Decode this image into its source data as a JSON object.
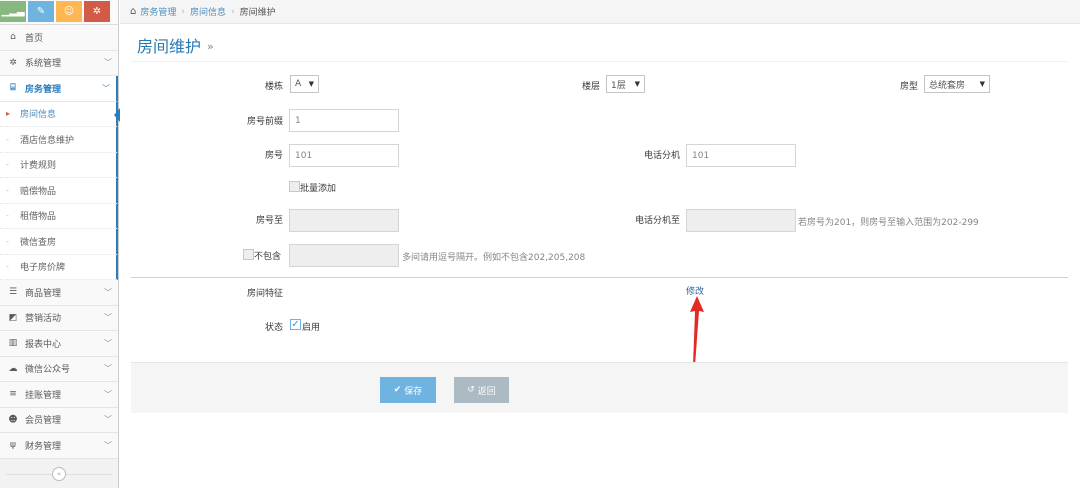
{
  "breadcrumb": {
    "items": [
      "房务管理",
      "房间信息",
      "房间维护"
    ]
  },
  "page": {
    "title": "房间维护",
    "title_arrow": "»"
  },
  "sidebar": {
    "shortcut_icons": [
      "signal-icon",
      "pencil-icon",
      "users-icon",
      "cogs-icon"
    ],
    "items": [
      {
        "label": "首页",
        "icon": "home-icon",
        "glyph": "⌂",
        "has_chevron": false
      },
      {
        "label": "系统管理",
        "icon": "gear-icon",
        "glyph": "✲",
        "has_chevron": true
      },
      {
        "label": "房务管理",
        "icon": "bank-icon",
        "glyph": "⌸",
        "has_chevron": true,
        "active": true
      },
      {
        "label": "商品管理",
        "icon": "database-icon",
        "glyph": "☰",
        "has_chevron": true
      },
      {
        "label": "营销活动",
        "icon": "gift-icon",
        "glyph": "◩",
        "has_chevron": true
      },
      {
        "label": "报表中心",
        "icon": "bar-chart-icon",
        "glyph": "▥",
        "has_chevron": true
      },
      {
        "label": "微信公众号",
        "icon": "cloud-icon",
        "glyph": "☁",
        "has_chevron": true
      },
      {
        "label": "挂账管理",
        "icon": "list-icon",
        "glyph": "≡",
        "has_chevron": true
      },
      {
        "label": "会员管理",
        "icon": "group-icon",
        "glyph": "☻",
        "has_chevron": true
      },
      {
        "label": "财务管理",
        "icon": "cutlery-icon",
        "glyph": "ψ",
        "has_chevron": true
      }
    ],
    "subitems": [
      "房间信息",
      "酒店信息维护",
      "计费规则",
      "赔偿物品",
      "租借物品",
      "微信查房",
      "电子房价牌"
    ],
    "current_subitem": "房间信息"
  },
  "form": {
    "building_label": "楼栋",
    "building_value": "A",
    "floor_label": "楼层",
    "floor_value": "1层",
    "room_type_label": "房型",
    "room_type_value": "总统套房",
    "prefix_label": "房号前缀",
    "prefix_value": "1",
    "room_no_label": "房号",
    "room_no_value": "101",
    "phone_ext_label": "电话分机",
    "phone_ext_value": "101",
    "batch_add_label": "批量添加",
    "room_no_to_label": "房号至",
    "phone_ext_to_label": "电话分机至",
    "phone_ext_to_hint": "若房号为201，则房号至输入范围为202-299",
    "exclude_label": "不包含",
    "exclude_hint": "多间请用逗号隔开。例如不包含202,205,208",
    "features_label": "房间特征",
    "edit_link": "修改",
    "status_label": "状态",
    "status_enabled_label": "启用"
  },
  "actions": {
    "save": "保存",
    "back": "返回"
  },
  "colors": {
    "accent": "#2679b5",
    "save_button": "#6fb3e0",
    "back_button": "#abbac3",
    "annotation_arrow": "#e32b23"
  }
}
